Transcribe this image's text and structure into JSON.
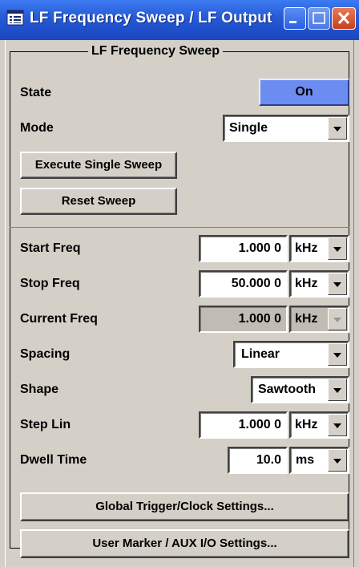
{
  "window": {
    "title": "LF Frequency Sweep / LF Output",
    "icon": "dialog-icon"
  },
  "group": {
    "title": "LF Frequency Sweep"
  },
  "state": {
    "label": "State",
    "button": "On"
  },
  "mode": {
    "label": "Mode",
    "value": "Single"
  },
  "actions": {
    "execute": "Execute Single Sweep",
    "reset": "Reset Sweep"
  },
  "start_freq": {
    "label": "Start Freq",
    "value": "1.000 0",
    "unit": "kHz"
  },
  "stop_freq": {
    "label": "Stop Freq",
    "value": "50.000 0",
    "unit": "kHz"
  },
  "current_freq": {
    "label": "Current Freq",
    "value": "1.000 0",
    "unit": "kHz"
  },
  "spacing": {
    "label": "Spacing",
    "value": "Linear"
  },
  "shape": {
    "label": "Shape",
    "value": "Sawtooth"
  },
  "step_lin": {
    "label": "Step Lin",
    "value": "1.000 0",
    "unit": "kHz"
  },
  "dwell_time": {
    "label": "Dwell Time",
    "value": "10.0",
    "unit": "ms"
  },
  "buttons": {
    "trigger": "Global Trigger/Clock Settings...",
    "marker": "User Marker / AUX I/O Settings..."
  },
  "colors": {
    "titlebar": "#2559d6",
    "on_button": "#6b8cf0",
    "panel": "#d4d0c8"
  }
}
